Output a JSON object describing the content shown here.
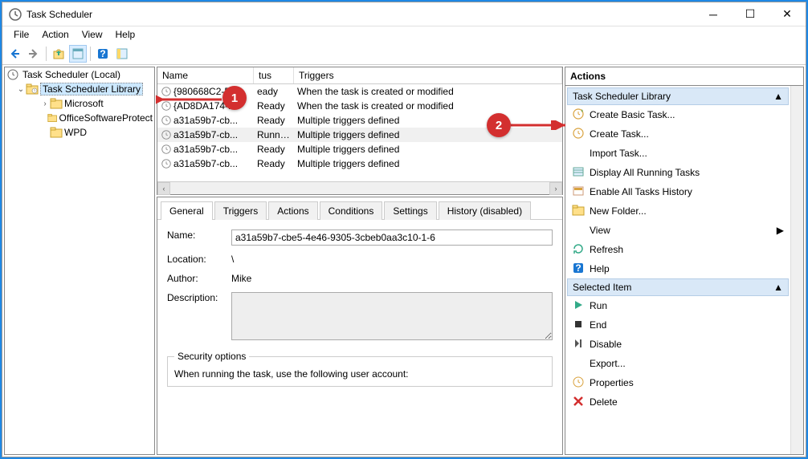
{
  "window": {
    "title": "Task Scheduler"
  },
  "menu": {
    "file": "File",
    "action": "Action",
    "view": "View",
    "help": "Help"
  },
  "tree": {
    "root": "Task Scheduler (Local)",
    "library": "Task Scheduler Library",
    "children": [
      "Microsoft",
      "OfficeSoftwareProtect",
      "WPD"
    ]
  },
  "columns": {
    "name": "Name",
    "status": "tus",
    "triggers": "Triggers"
  },
  "tasks": [
    {
      "name": "{980668C2-E...",
      "status": "eady",
      "triggers": "When the task is created or modified",
      "selected": false
    },
    {
      "name": "{AD8DA174-...",
      "status": "Ready",
      "triggers": "When the task is created or modified",
      "selected": false
    },
    {
      "name": "a31a59b7-cb...",
      "status": "Ready",
      "triggers": "Multiple triggers defined",
      "selected": false
    },
    {
      "name": "a31a59b7-cb...",
      "status": "Running",
      "triggers": "Multiple triggers defined",
      "selected": true
    },
    {
      "name": "a31a59b7-cb...",
      "status": "Ready",
      "triggers": "Multiple triggers defined",
      "selected": false
    },
    {
      "name": "a31a59b7-cb...",
      "status": "Ready",
      "triggers": "Multiple triggers defined",
      "selected": false
    }
  ],
  "tabs": [
    "General",
    "Triggers",
    "Actions",
    "Conditions",
    "Settings",
    "History (disabled)"
  ],
  "details": {
    "name_label": "Name:",
    "name_value": "a31a59b7-cbe5-4e46-9305-3cbeb0aa3c10-1-6",
    "location_label": "Location:",
    "location_value": "\\",
    "author_label": "Author:",
    "author_value": "Mike",
    "description_label": "Description:",
    "description_value": "",
    "security_legend": "Security options",
    "security_text": "When running the task, use the following user account:"
  },
  "actions": {
    "header": "Actions",
    "section1": "Task Scheduler Library",
    "items1": [
      "Create Basic Task...",
      "Create Task...",
      "Import Task...",
      "Display All Running Tasks",
      "Enable All Tasks History",
      "New Folder...",
      "View",
      "Refresh",
      "Help"
    ],
    "section2": "Selected Item",
    "items2": [
      "Run",
      "End",
      "Disable",
      "Export...",
      "Properties",
      "Delete"
    ]
  },
  "annotations": {
    "one": "1",
    "two": "2"
  }
}
